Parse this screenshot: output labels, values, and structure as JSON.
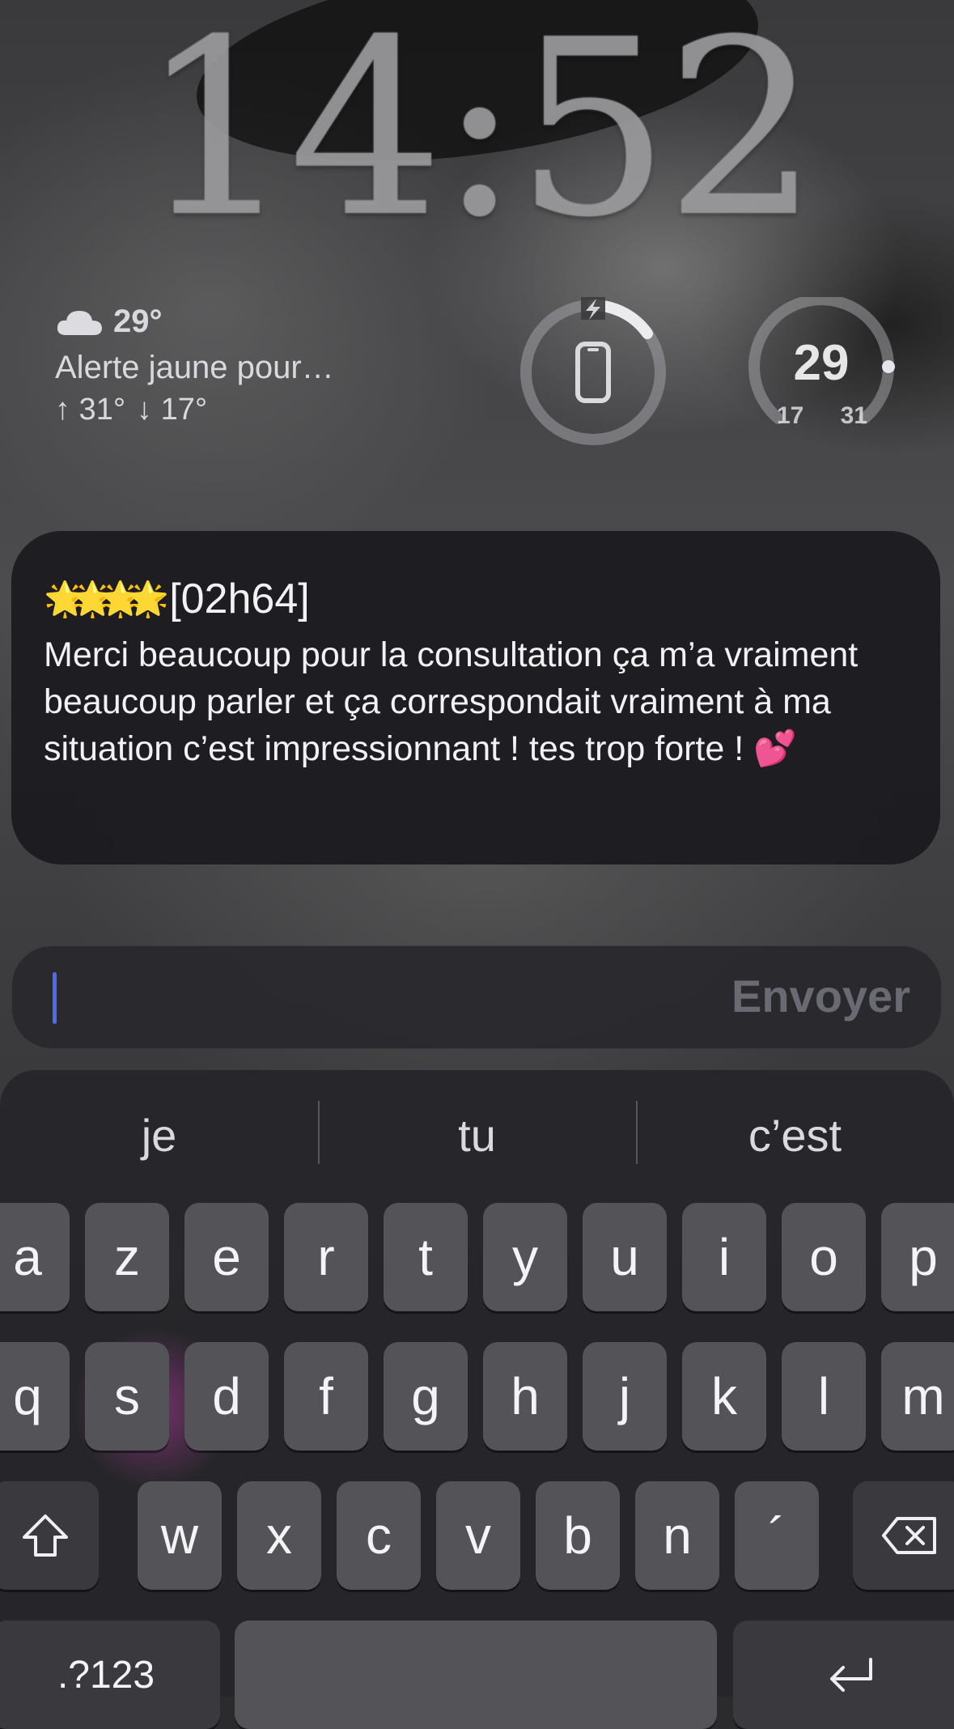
{
  "lockscreen": {
    "time": "14:52"
  },
  "weather": {
    "temp": "29°",
    "alert": "Alerte jaune pour…",
    "high": "↑ 31°",
    "low": "↓ 17°",
    "icon": "cloud-icon"
  },
  "battery_widget": {
    "icon": "phone-icon",
    "charging_icon": "bolt-icon",
    "level_fraction": 0.2
  },
  "temp_widget": {
    "current": "29",
    "min": "17",
    "max": "31"
  },
  "notification": {
    "sender_emoji": "🌟🌟🌟🌟",
    "sender": "[02h64]",
    "message": "Merci beaucoup pour la consultation ça m’a vraiment beaucoup parler et ça correspondait vraiment à ma situation c’est impressionnant ! tes trop forte ! 💕"
  },
  "reply": {
    "send_label": "Envoyer"
  },
  "keyboard": {
    "suggestions": [
      "je",
      "tu",
      "c’est"
    ],
    "row1": [
      "a",
      "z",
      "e",
      "r",
      "t",
      "y",
      "u",
      "i",
      "o",
      "p"
    ],
    "row2": [
      "q",
      "s",
      "d",
      "f",
      "g",
      "h",
      "j",
      "k",
      "l",
      "m"
    ],
    "row3": [
      "w",
      "x",
      "c",
      "v",
      "b",
      "n",
      "´"
    ],
    "numbers_label": ".?123"
  }
}
